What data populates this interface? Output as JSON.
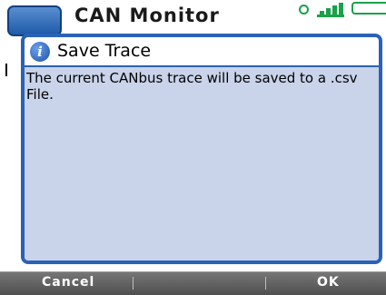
{
  "app": {
    "title": "CAN Monitor"
  },
  "status": {
    "icons": [
      "search-icon",
      "signal-icon",
      "battery-icon"
    ]
  },
  "dialog": {
    "icon": "info-icon",
    "icon_glyph": "i",
    "title": "Save Trace",
    "message": "The current CANbus trace will be saved to a .csv File."
  },
  "softkeys": {
    "left": "Cancel",
    "right": "OK"
  },
  "colors": {
    "accent": "#2a62b6",
    "dialog_bg": "#c9d3e9",
    "softkey_bar": "#5f5f5f",
    "status_green": "#1aa14a"
  }
}
